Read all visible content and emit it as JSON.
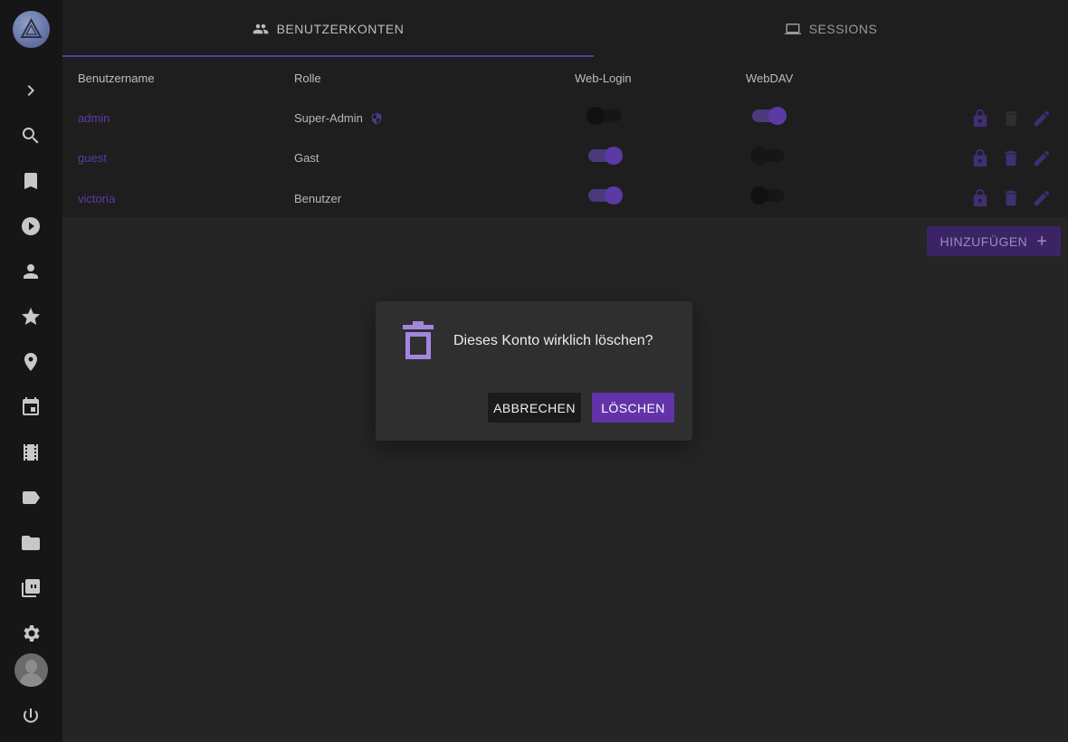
{
  "tabs": [
    {
      "label": "BENUTZERKONTEN",
      "icon": "people-icon",
      "active": true
    },
    {
      "label": "SESSIONS",
      "icon": "laptop-icon",
      "active": false
    }
  ],
  "table": {
    "headers": [
      "Benutzername",
      "Rolle",
      "Web-Login",
      "WebDAV"
    ],
    "rows": [
      {
        "username": "admin",
        "role": "Super-Admin",
        "role_badge": "shield-icon",
        "web_login": false,
        "webdav": true
      },
      {
        "username": "guest",
        "role": "Gast",
        "web_login": true,
        "webdav": false
      },
      {
        "username": "victoria",
        "role": "Benutzer",
        "web_login": true,
        "webdav": false
      }
    ]
  },
  "add_button": {
    "label": "HINZUFÜGEN",
    "icon": "plus"
  },
  "dialog": {
    "icon": "trash-icon",
    "message": "Dieses Konto wirklich löschen?",
    "cancel_label": "ABBRECHEN",
    "delete_label": "LÖSCHEN"
  },
  "sidebar": {
    "items": [
      "expand-icon",
      "search-icon",
      "bookmark-icon",
      "play-icon",
      "person-icon",
      "star-icon",
      "place-icon",
      "calendar-icon",
      "film-icon",
      "label-icon",
      "folder-icon",
      "library-icon",
      "settings-icon",
      "avatar",
      "power-icon"
    ]
  },
  "colors": {
    "accent": "#6233a8",
    "accent_light": "#a385e0",
    "sidebar_bg": "#161616",
    "page_bg": "#252525"
  }
}
